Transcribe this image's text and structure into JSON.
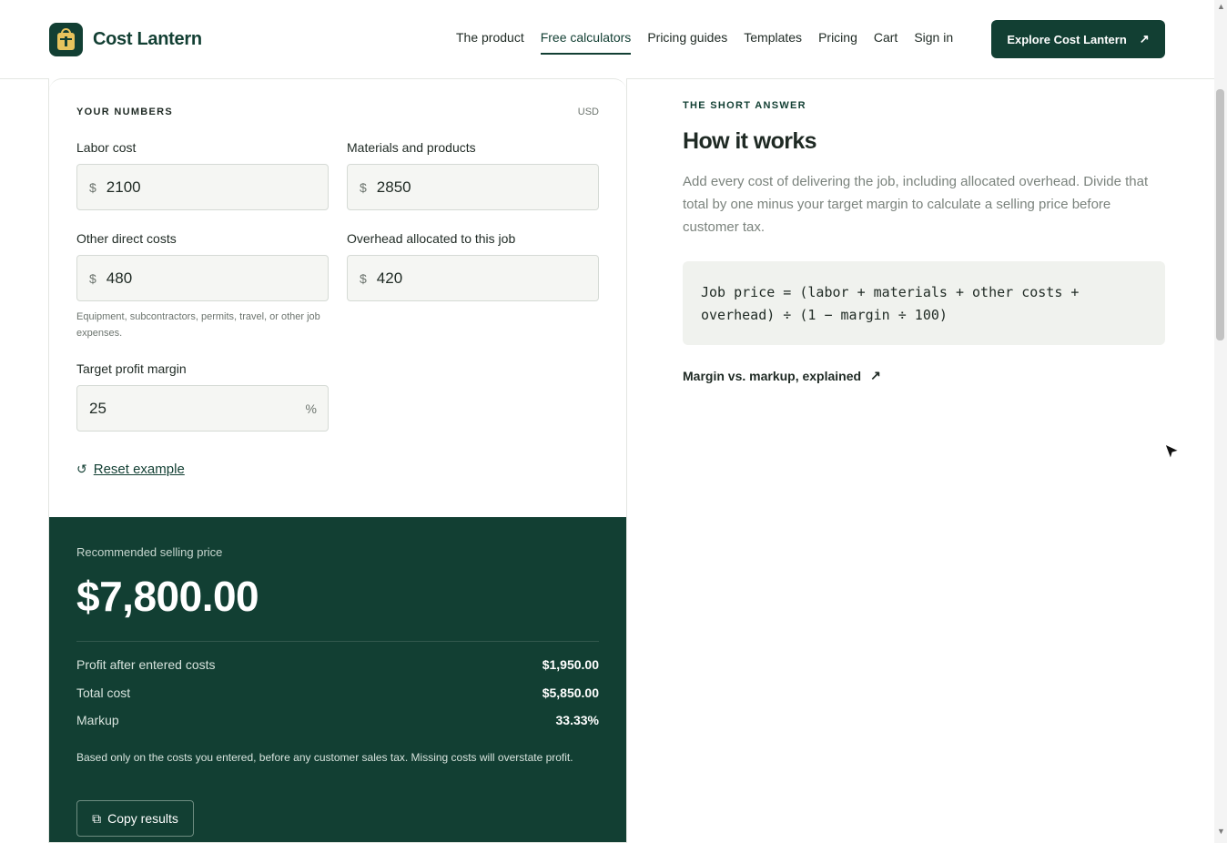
{
  "header": {
    "brand": "Cost Lantern",
    "nav": [
      {
        "label": "The product",
        "active": false
      },
      {
        "label": "Free calculators",
        "active": true
      },
      {
        "label": "Pricing guides",
        "active": false
      },
      {
        "label": "Templates",
        "active": false
      },
      {
        "label": "Pricing",
        "active": false
      },
      {
        "label": "Cart",
        "active": false
      },
      {
        "label": "Sign in",
        "active": false
      }
    ],
    "cta_label": "Explore Cost Lantern",
    "cta_icon": "arrow-up-right-icon"
  },
  "calculator": {
    "section_label": "YOUR NUMBERS",
    "currency": "USD",
    "fields": {
      "labor": {
        "label": "Labor cost",
        "prefix": "$",
        "value": "2100"
      },
      "materials": {
        "label": "Materials and products",
        "prefix": "$",
        "value": "2850"
      },
      "other": {
        "label": "Other direct costs",
        "prefix": "$",
        "value": "480"
      },
      "overhead": {
        "label": "Overhead allocated to this job",
        "prefix": "$",
        "value": "420"
      },
      "margin": {
        "label": "Target profit margin",
        "suffix": "%",
        "value": "25"
      }
    },
    "other_help": "Equipment, subcontractors, permits, travel, or other job expenses.",
    "reset_label": "Reset example"
  },
  "result": {
    "label": "Recommended selling price",
    "price": "$7,800.00",
    "rows": [
      {
        "label": "Profit after entered costs",
        "value": "$1,950.00"
      },
      {
        "label": "Total cost",
        "value": "$5,850.00"
      },
      {
        "label": "Markup",
        "value": "33.33%"
      }
    ],
    "note": "Based only on the costs you entered, before any customer sales tax. Missing costs will overstate profit.",
    "copy_label": "Copy results"
  },
  "explainer": {
    "eyebrow": "THE SHORT ANSWER",
    "title": "How it works",
    "body": "Add every cost of delivering the job, including allocated overhead. Divide that total by one minus your target margin to calculate a selling price before customer tax.",
    "formula_line1": "Job price = (labor + materials + other costs +",
    "formula_line2": "overhead) ÷ (1 − margin ÷ 100)",
    "link_label": "Margin vs. markup, explained"
  },
  "colors": {
    "brand": "#123f33",
    "accent": "#e7c35d",
    "input_bg": "#f5f6f3",
    "formula_bg": "#f0f2ee"
  }
}
